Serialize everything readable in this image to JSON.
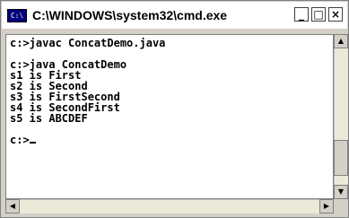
{
  "window": {
    "title": "C:\\WINDOWS\\system32\\cmd.exe",
    "icon_label": "C:\\",
    "minimize_glyph": "_",
    "maximize_glyph": "□",
    "close_glyph": "×"
  },
  "console": {
    "lines": [
      "c:>javac ConcatDemo.java",
      "",
      "c:>java ConcatDemo",
      "s1 is First",
      "s2 is Second",
      "s3 is FirstSecond",
      "s4 is SecondFirst",
      "s5 is ABCDEF",
      "",
      "c:>"
    ]
  },
  "scrollbars": {
    "up": "▲",
    "down": "▼",
    "left": "◀",
    "right": "▶"
  }
}
